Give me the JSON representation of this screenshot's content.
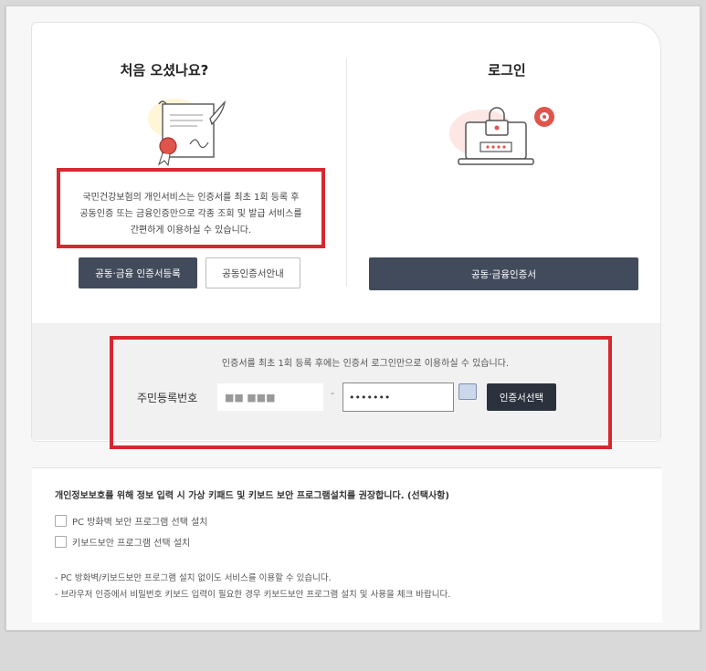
{
  "left_section": {
    "title": "처음 오셨나요?",
    "intro_line1": "국민건강보험의 개인서비스는 인증서를 최초 1회 등록 후",
    "intro_line2": "공동인증 또는 금융인증만으로 각종 조회 및 발급 서비스를",
    "intro_line3": "간편하게 이용하실 수 있습니다.",
    "register_button": "공동·금융 인증서등록",
    "guide_button": "공동인증서안내"
  },
  "right_section": {
    "title": "로그인",
    "login_button": "공동·금융인증서"
  },
  "login_panel": {
    "notice": "인증서를 최초 1회 등록 후에는 인증서 로그인만으로 이용하실 수 있습니다.",
    "rrn_label": "주민등록번호",
    "rrn_first_value": "■■ ■■■",
    "rrn_dash": "-",
    "rrn_second_value": "•••••••",
    "select_cert_button": "인증서선택"
  },
  "security": {
    "title": "개인정보보호를 위해 정보 입력 시 가상 키패드 및 키보드 보안 프로그램설치를 권장합니다. (선택사항)",
    "options": [
      {
        "label": "PC 방화벽 보안 프로그램 선택 설치",
        "checked": false
      },
      {
        "label": "키보드보안 프로그램 선택 설치",
        "checked": false
      }
    ],
    "note1": "- PC 방화벽/키보드보안 프로그램 설치 없이도 서비스를 이용할 수 있습니다.",
    "note2": "- 브라우저 인증에서 비밀번호 키보드 입력이 필요한 경우 키보드보안 프로그램 설치 및 사용을 체크 바랍니다."
  },
  "colors": {
    "highlight_red": "#d7272f",
    "button_dark": "#424b5c"
  }
}
